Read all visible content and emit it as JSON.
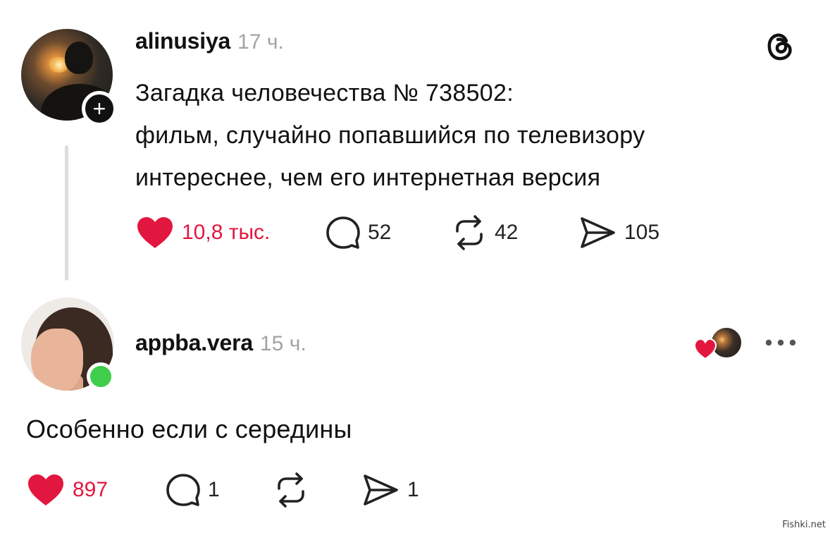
{
  "post": {
    "username": "alinusiya",
    "time": "17 ч.",
    "text_lines": [
      "Загадка человечества № 738502:",
      "фильм, случайно попавшийся по телевизору",
      "интереснее, чем его интернетная версия"
    ],
    "likes": "10,8 тыс.",
    "replies": "52",
    "reposts": "42",
    "shares": "105"
  },
  "reply": {
    "username": "appba.vera",
    "time": "15 ч.",
    "text": "Особенно если с середины",
    "likes": "897",
    "replies": "1",
    "shares": "1"
  },
  "watermark": "Fishki.net",
  "colors": {
    "like_red": "#e2173f",
    "online_green": "#3fcd4a",
    "muted_gray": "#a3a3a3"
  },
  "icons": [
    "threads-logo-icon",
    "heart-icon",
    "reply-bubble-icon",
    "repost-icon",
    "share-send-icon",
    "more-dots-icon",
    "plus-icon"
  ]
}
